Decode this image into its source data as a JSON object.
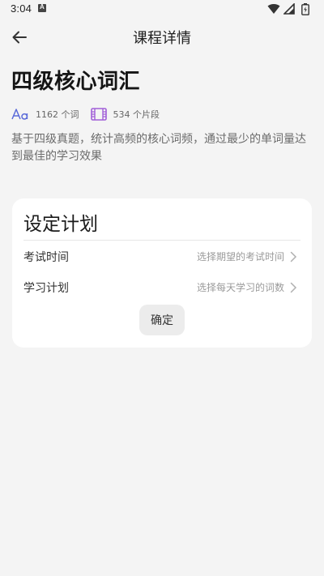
{
  "status_bar": {
    "time": "3:04",
    "notification_icon": "a-badge-icon",
    "icons": [
      "wifi-icon",
      "signal-icon",
      "battery-icon"
    ]
  },
  "app_bar": {
    "back_icon": "arrow-left-icon",
    "title": "课程详情"
  },
  "course": {
    "title": "四级核心词汇",
    "stats": [
      {
        "icon": "text-size-icon",
        "text": "1162 个词"
      },
      {
        "icon": "film-icon",
        "text": "534 个片段"
      }
    ],
    "description": "基于四级真题，统计高频的核心词频，通过最少的单词量达到最佳的学习效果"
  },
  "plan": {
    "title": "设定计划",
    "rows": [
      {
        "label": "考试时间",
        "value": "选择期望的考试时间"
      },
      {
        "label": "学习计划",
        "value": "选择每天学习的词数"
      }
    ],
    "confirm_label": "确定"
  },
  "colors": {
    "accent_purple": "#7a4fd6",
    "background": "#f4f4f4",
    "card": "#ffffff"
  }
}
